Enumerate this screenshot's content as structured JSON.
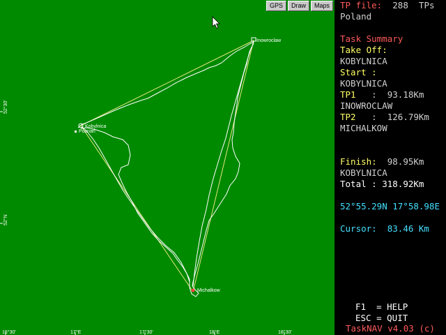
{
  "toolbar": {
    "gps": "GPS",
    "draw": "Draw",
    "maps": "Maps"
  },
  "map": {
    "waypoints": {
      "kobylnica": "Kobylnica",
      "poznan": "Poznan",
      "inowroclaw": "Inowroclaw",
      "michalkow": "Michalkow"
    },
    "lat_labels": [
      "52°30'",
      "52°N"
    ],
    "lon_labels": [
      "16°30'",
      "17°E",
      "17°30'",
      "18°E",
      "18°30'"
    ]
  },
  "panel": {
    "tp_file_label": "TP file:",
    "tp_count": "288",
    "tps_label": "TPs",
    "region": "Poland",
    "task_summary": "Task Summary",
    "takeoff_label": "Take Off:",
    "takeoff_name": "KOBYLNICA",
    "start_label": "Start :",
    "start_name": "KOBYLNICA",
    "tp1_label": "TP1",
    "tp1_sep": ":",
    "tp1_dist": "93.18Km",
    "tp1_name": "INOWROCLAW",
    "tp2_label": "TP2",
    "tp2_sep": ":",
    "tp2_dist": "126.79Km",
    "tp2_name": "MICHALKOW",
    "finish_label": "Finish:",
    "finish_dist": "98.95Km",
    "finish_name": "KOBYLNICA",
    "total_label": "Total :",
    "total_dist": "318.92Km",
    "position": "52°55.29N 17°58.98E",
    "cursor_label": "Cursor:",
    "cursor_dist": "83.46 Km",
    "help": "F1  = HELP",
    "quit": "ESC = QUIT",
    "version": "TaskNAV v4.03 (c)"
  }
}
